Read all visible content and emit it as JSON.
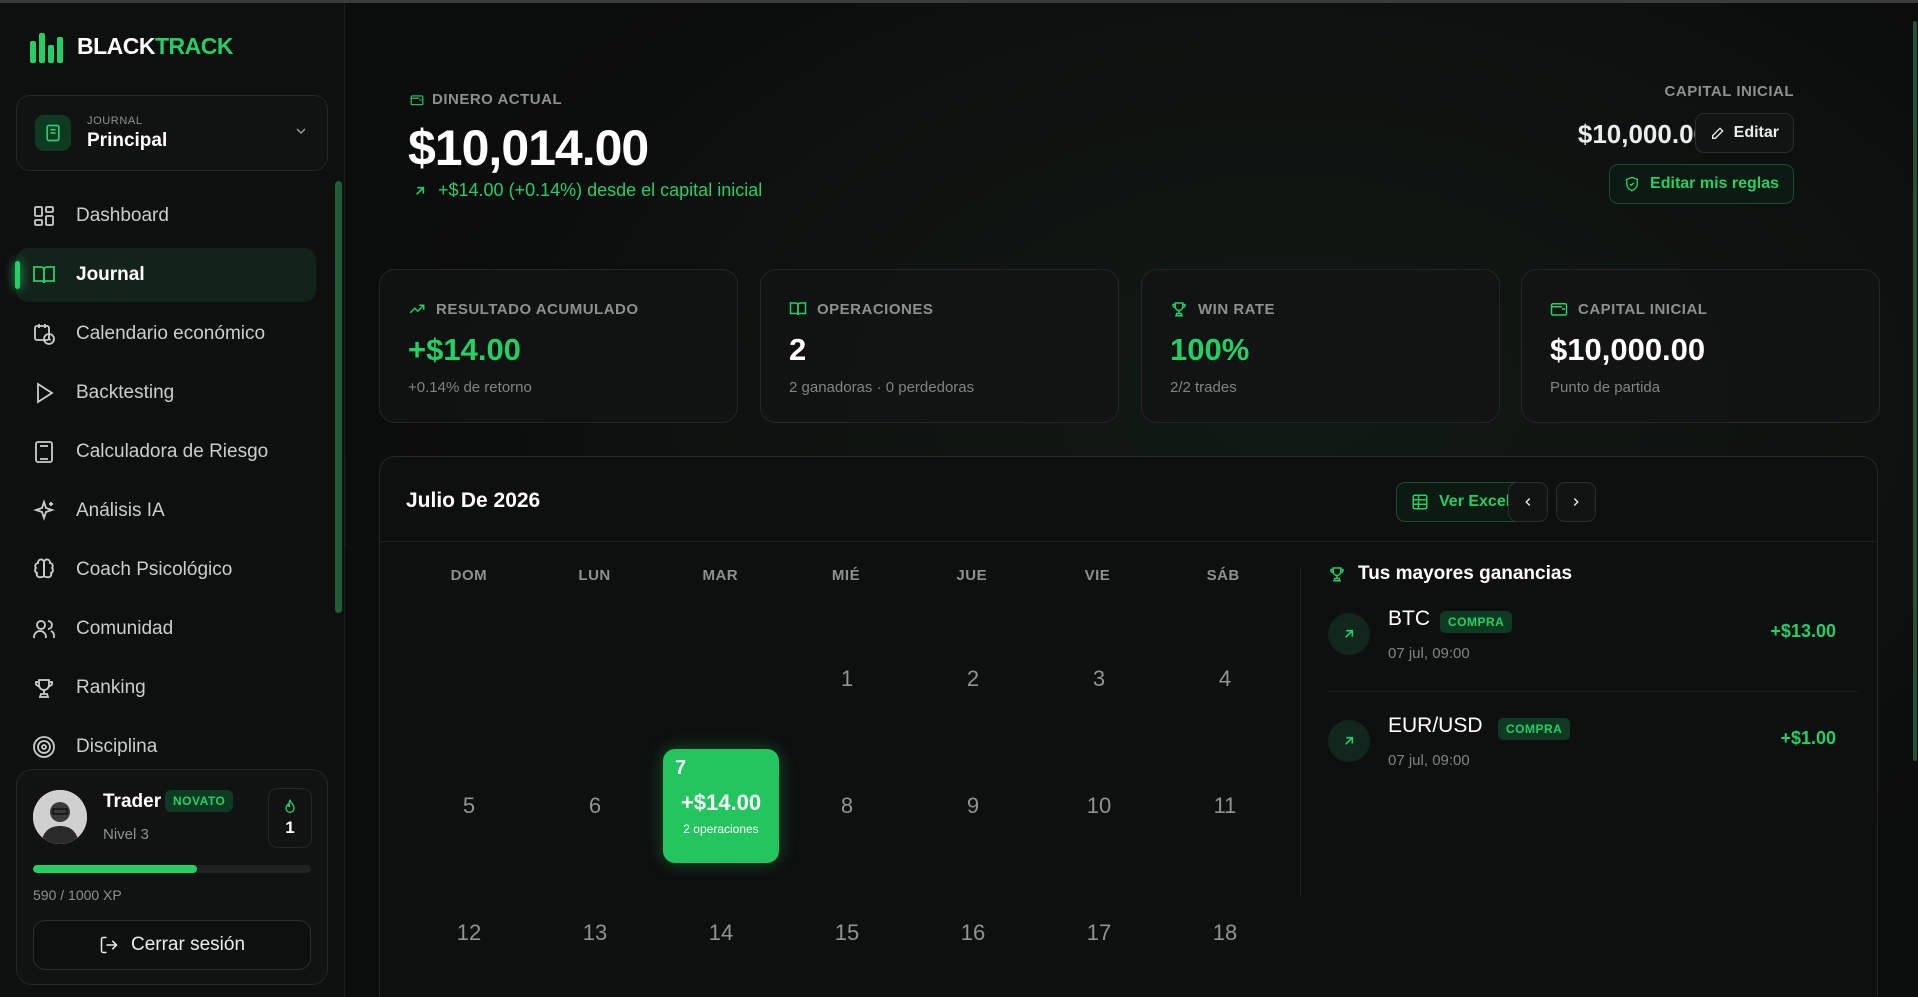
{
  "brand": {
    "part1": "BLACK",
    "part2": "TRACK"
  },
  "journal": {
    "label": "JOURNAL",
    "value": "Principal"
  },
  "nav": [
    {
      "label": "Dashboard",
      "icon": "grid-icon"
    },
    {
      "label": "Journal",
      "icon": "book-icon",
      "active": true
    },
    {
      "label": "Calendario económico",
      "icon": "calendar-clock-icon"
    },
    {
      "label": "Backtesting",
      "icon": "play-icon"
    },
    {
      "label": "Calculadora de Riesgo",
      "icon": "calculator-icon"
    },
    {
      "label": "Análisis IA",
      "icon": "sparkles-icon"
    },
    {
      "label": "Coach Psicológico",
      "icon": "brain-icon"
    },
    {
      "label": "Comunidad",
      "icon": "users-icon"
    },
    {
      "label": "Ranking",
      "icon": "trophy-icon"
    },
    {
      "label": "Disciplina",
      "icon": "target-icon"
    }
  ],
  "user": {
    "name": "Trader",
    "badge": "NOVATO",
    "level": "Nivel 3",
    "streak": "1",
    "xp_text": "590 / 1000 XP",
    "xp_fraction": 0.59,
    "logout": "Cerrar sesión"
  },
  "balance": {
    "label": "DINERO ACTUAL",
    "value": "$10,014.00",
    "change": "+$14.00 (+0.14%) desde el capital inicial"
  },
  "capital": {
    "label": "CAPITAL INICIAL",
    "value": "$10,000.00",
    "edit": "Editar",
    "rules": "Editar mis reglas"
  },
  "stats": [
    {
      "label": "RESULTADO ACUMULADO",
      "value": "+$14.00",
      "sub": "+0.14% de retorno",
      "icon": "trending-up-icon",
      "green": true
    },
    {
      "label": "OPERACIONES",
      "value": "2",
      "sub": "2 ganadoras · 0 perdedoras",
      "icon": "book-icon",
      "green": false
    },
    {
      "label": "WIN RATE",
      "value": "100%",
      "sub": "2/2 trades",
      "icon": "trophy-icon",
      "green": true
    },
    {
      "label": "CAPITAL INICIAL",
      "value": "$10,000.00",
      "sub": "Punto de partida",
      "icon": "wallet-icon",
      "green": false
    }
  ],
  "calendar": {
    "title": "Julio De 2026",
    "excel": "Ver Excel",
    "weekdays": [
      "DOM",
      "LUN",
      "MAR",
      "MIÉ",
      "JUE",
      "VIE",
      "SÁB"
    ],
    "weeks": [
      [
        "",
        "",
        "",
        "1",
        "2",
        "3",
        "4"
      ],
      [
        "5",
        "6",
        "7",
        "8",
        "9",
        "10",
        "11"
      ],
      [
        "12",
        "13",
        "14",
        "15",
        "16",
        "17",
        "18"
      ]
    ],
    "trade_day": {
      "day": "7",
      "amount": "+$14.00",
      "ops": "2 operaciones"
    }
  },
  "gains": {
    "title": "Tus mayores ganancias",
    "items": [
      {
        "symbol": "BTC",
        "side": "COMPRA",
        "time": "07 jul, 09:00",
        "value": "+$13.00"
      },
      {
        "symbol": "EUR/USD",
        "side": "COMPRA",
        "time": "07 jul, 09:00",
        "value": "+$1.00"
      }
    ]
  },
  "colors": {
    "accent": "#22d066",
    "background": "#0b0c0c"
  }
}
